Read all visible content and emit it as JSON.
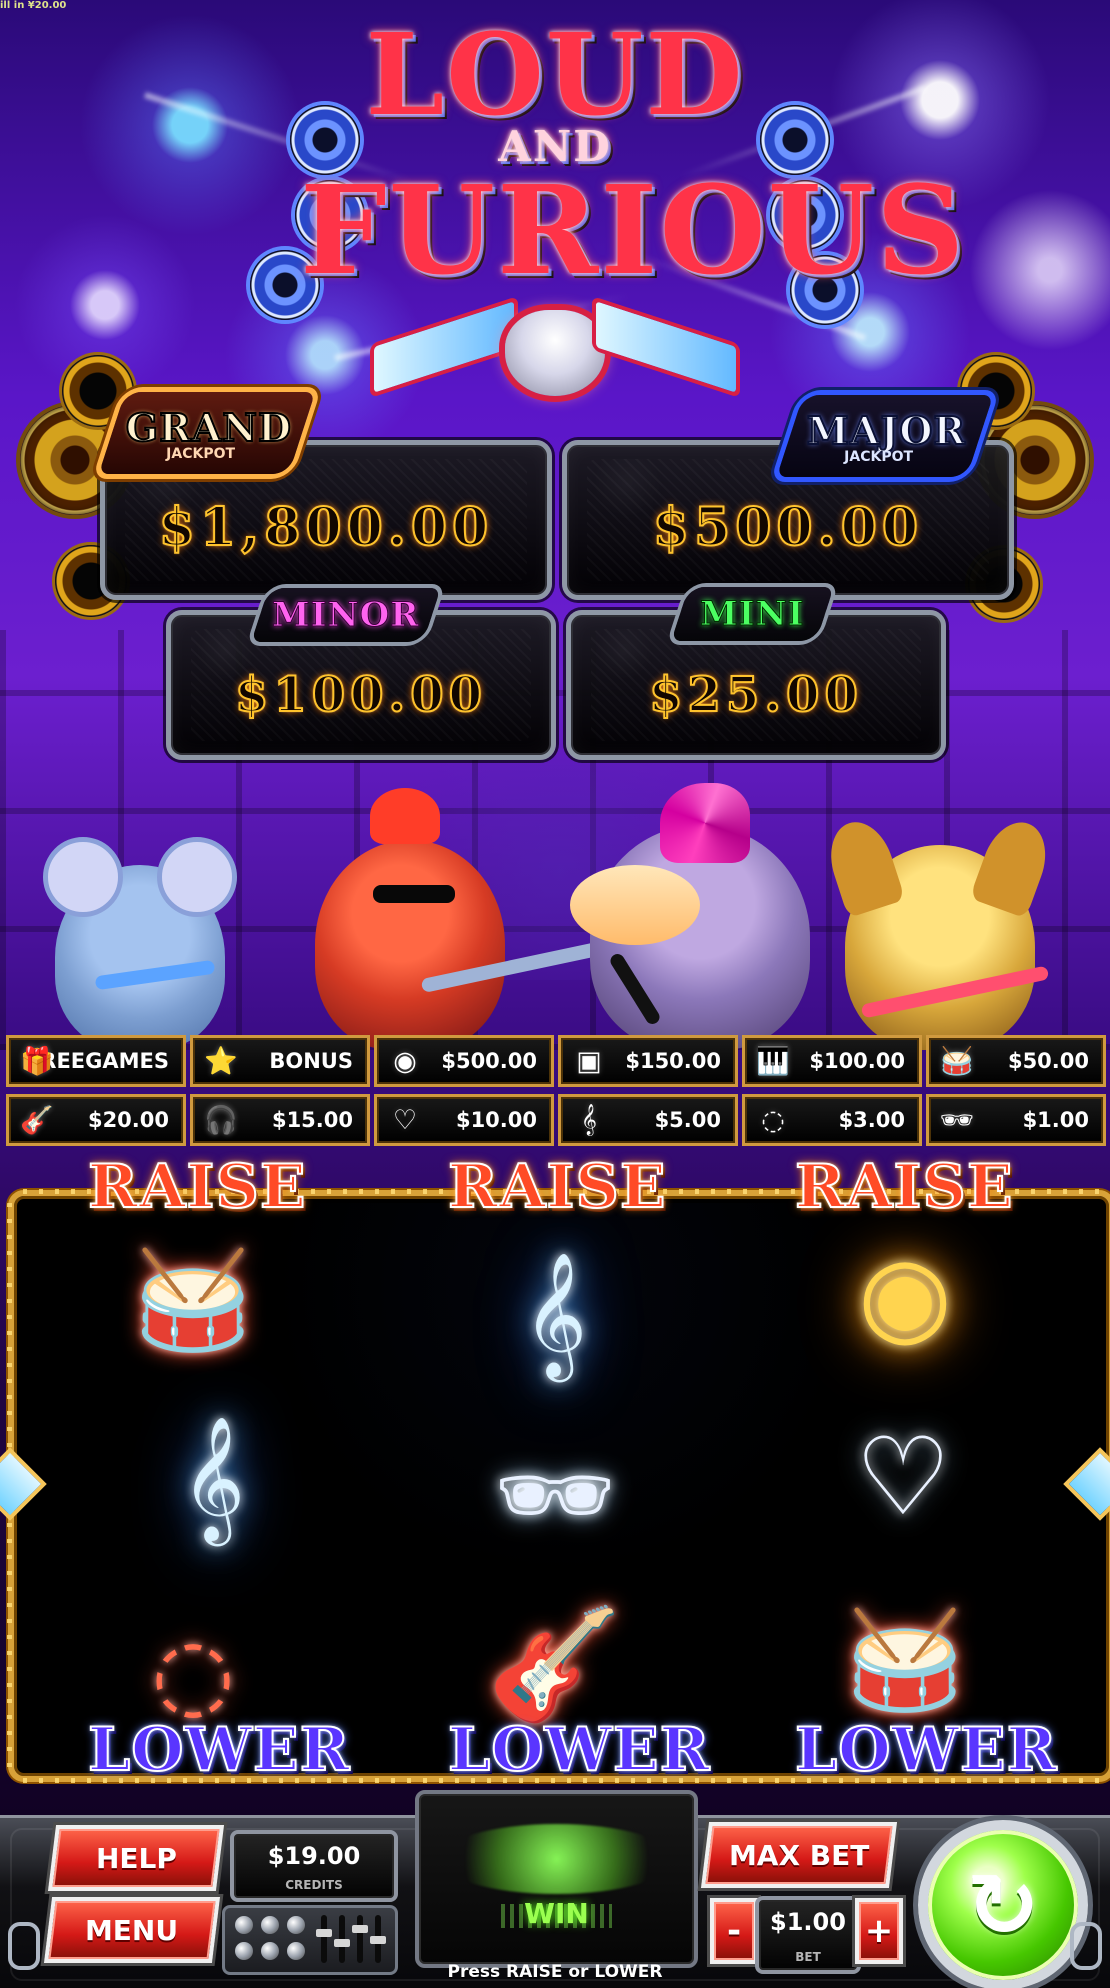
{
  "top_status": "ill in ¥20.00",
  "logo": {
    "line1": "LOUD",
    "line2": "AND",
    "line3": "FURIOUS"
  },
  "jackpots": {
    "grand": {
      "title": "GRAND",
      "subtitle": "JACKPOT",
      "amount": "$1,800.00"
    },
    "major": {
      "title": "MAJOR",
      "subtitle": "JACKPOT",
      "amount": "$500.00"
    },
    "minor": {
      "title": "MINOR",
      "amount": "$100.00"
    },
    "mini": {
      "title": "MINI",
      "amount": "$25.00"
    }
  },
  "paytable": {
    "row1": [
      {
        "icon": "free-games-icon",
        "label": "FREEGAMES"
      },
      {
        "icon": "bonus-icon",
        "label": "BONUS"
      },
      {
        "icon": "gold-record-icon",
        "label": "$500.00"
      },
      {
        "icon": "speaker-stack-icon",
        "label": "$150.00"
      },
      {
        "icon": "keyboard-icon",
        "label": "$100.00"
      },
      {
        "icon": "drum-kit-icon",
        "label": "$50.00"
      }
    ],
    "row2": [
      {
        "icon": "guitar-icon",
        "label": "$20.00"
      },
      {
        "icon": "headphones-icon",
        "label": "$15.00"
      },
      {
        "icon": "chain-heart-icon",
        "label": "$10.00"
      },
      {
        "icon": "treble-clef-icon",
        "label": "$5.00"
      },
      {
        "icon": "collar-icon",
        "label": "$3.00"
      },
      {
        "icon": "sunglasses-icon",
        "label": "$1.00"
      }
    ]
  },
  "reels": {
    "raise_label": "RAISE",
    "lower_label": "LOWER",
    "symbols": [
      "drum-kit-icon",
      "treble-clef-icon",
      "gold-record-icon",
      "treble-clef-icon",
      "sunglasses-icon",
      "chain-heart-icon",
      "collar-icon",
      "guitar-icon",
      "drum-kit-icon"
    ]
  },
  "controls": {
    "help": "HELP",
    "menu": "MENU",
    "credits_value": "$19.00",
    "credits_label": "CREDITS",
    "win_label": "WIN",
    "max_bet": "MAX BET",
    "minus": "-",
    "plus": "+",
    "bet_value": "$1.00",
    "bet_label": "BET",
    "prompt": "Press RAISE or LOWER",
    "spin_icon": "refresh-icon"
  },
  "colors": {
    "grand": "#ffb347",
    "major": "#3157ff",
    "minor": "#ff63ef",
    "mini": "#4cff62",
    "raise": "#ff4b26",
    "lower": "#5a35ff",
    "button_red": "#d51917",
    "spin_green": "#46c700",
    "win_green": "#9bff50"
  }
}
